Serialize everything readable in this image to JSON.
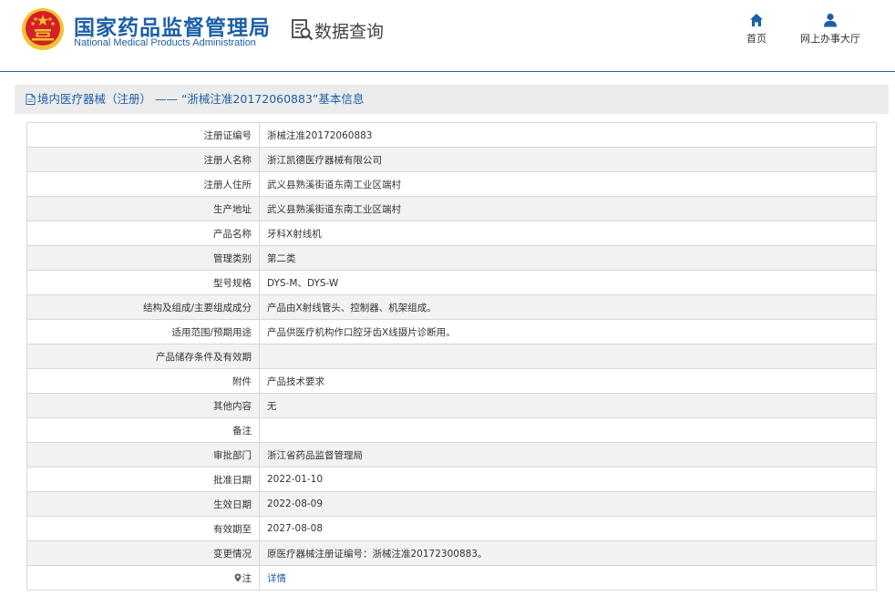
{
  "header": {
    "agency_cn": "国家药品监督管理局",
    "agency_en": "National Medical Products Administration",
    "page_title": "数据查询",
    "nav": [
      {
        "label": "首页",
        "icon": "home-icon"
      },
      {
        "label": "网上办事大厅",
        "icon": "user-icon"
      }
    ]
  },
  "panel": {
    "title": "境内医疗器械（注册） —— “浙械注准20172060883”基本信息"
  },
  "rows": [
    {
      "label": "注册证编号",
      "value": "浙械注准20172060883"
    },
    {
      "label": "注册人名称",
      "value": "浙江凯德医疗器械有限公司"
    },
    {
      "label": "注册人住所",
      "value": "武义县熟溪街道东南工业区端村"
    },
    {
      "label": "生产地址",
      "value": "武义县熟溪街道东南工业区端村"
    },
    {
      "label": "产品名称",
      "value": "牙科X射线机"
    },
    {
      "label": "管理类别",
      "value": "第二类"
    },
    {
      "label": "型号规格",
      "value": "DYS-M、DYS-W"
    },
    {
      "label": "结构及组成/主要组成成分",
      "value": "产品由X射线管头、控制器、机架组成。"
    },
    {
      "label": "适用范围/预期用途",
      "value": "产品供医疗机构作口腔牙齿X线摄片诊断用。"
    },
    {
      "label": "产品储存条件及有效期",
      "value": ""
    },
    {
      "label": "附件",
      "value": "产品技术要求"
    },
    {
      "label": "其他内容",
      "value": "无"
    },
    {
      "label": "备注",
      "value": ""
    },
    {
      "label": "审批部门",
      "value": "浙江省药品监督管理局"
    },
    {
      "label": "批准日期",
      "value": "2022-01-10"
    },
    {
      "label": "生效日期",
      "value": "2022-08-09"
    },
    {
      "label": "有效期至",
      "value": "2027-08-08"
    },
    {
      "label": "变更情况",
      "value": "原医疗器械注册证编号：浙械注准20172300883。"
    }
  ],
  "note_row": {
    "label": "注",
    "link": "详情"
  },
  "colors": {
    "brand_blue": "#1d5fa8",
    "emblem_red": "#d61f26",
    "emblem_gold": "#f2c230"
  }
}
